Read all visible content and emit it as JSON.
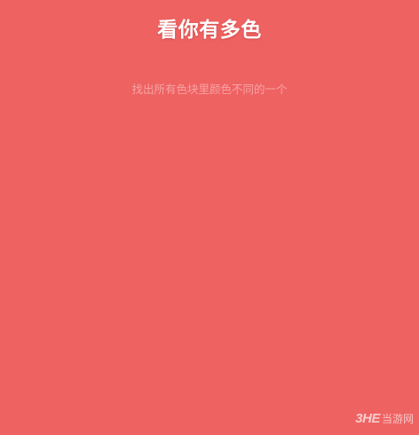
{
  "game": {
    "title": "看你有多色",
    "subtitle": "找出所有色块里颜色不同的一个"
  },
  "watermark": {
    "logo": "3HE",
    "text": "当游网"
  },
  "colors": {
    "background": "#ef6262",
    "title": "#ffffff",
    "subtitle": "#f6a3a3"
  }
}
